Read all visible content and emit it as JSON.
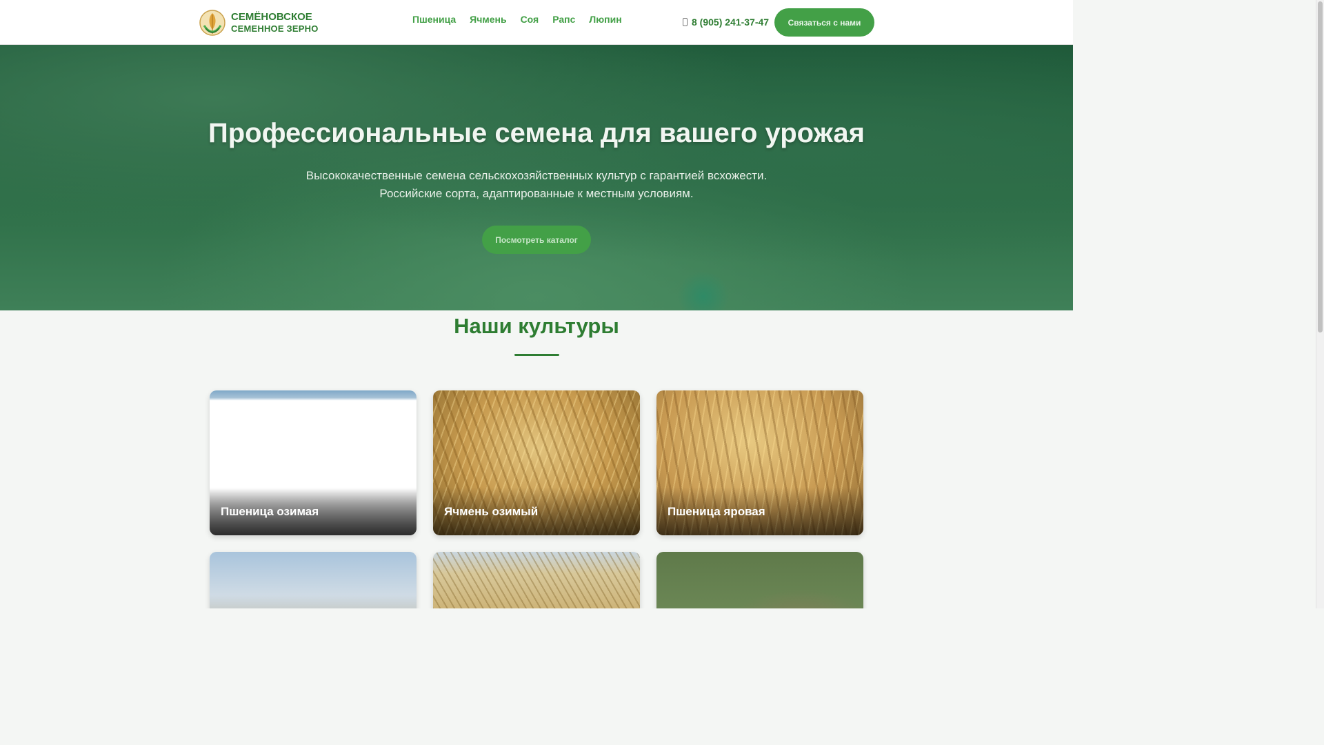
{
  "header": {
    "brand_line1": "СЕМЁНОВСКОЕ",
    "brand_line2": "СЕМЕННОЕ ЗЕРНО",
    "nav": [
      {
        "label": "Пшеница"
      },
      {
        "label": "Ячмень"
      },
      {
        "label": "Соя"
      },
      {
        "label": "Рапс"
      },
      {
        "label": "Люпин"
      }
    ],
    "phone": "8 (905) 241-37-47",
    "phone_icon": "phone-icon",
    "contact_label": "Связаться с нами"
  },
  "hero": {
    "title": "Профессиональные семена для вашего урожая",
    "subtitle_line1": "Высококачественные семена сельскохозяйственных культур с гарантией всхожести.",
    "subtitle_line2": "Российские сорта, адаптированные к местным условиям.",
    "cta_label": "Посмотреть каталог"
  },
  "cultures": {
    "title": "Наши культуры",
    "cards": [
      {
        "label": "Пшеница озимая"
      },
      {
        "label": "Ячмень озимый"
      },
      {
        "label": "Пшеница яровая"
      },
      {
        "label": ""
      },
      {
        "label": ""
      },
      {
        "label": ""
      }
    ]
  },
  "colors": {
    "brand_green": "#2e7d32",
    "accent_green": "#43a047"
  }
}
